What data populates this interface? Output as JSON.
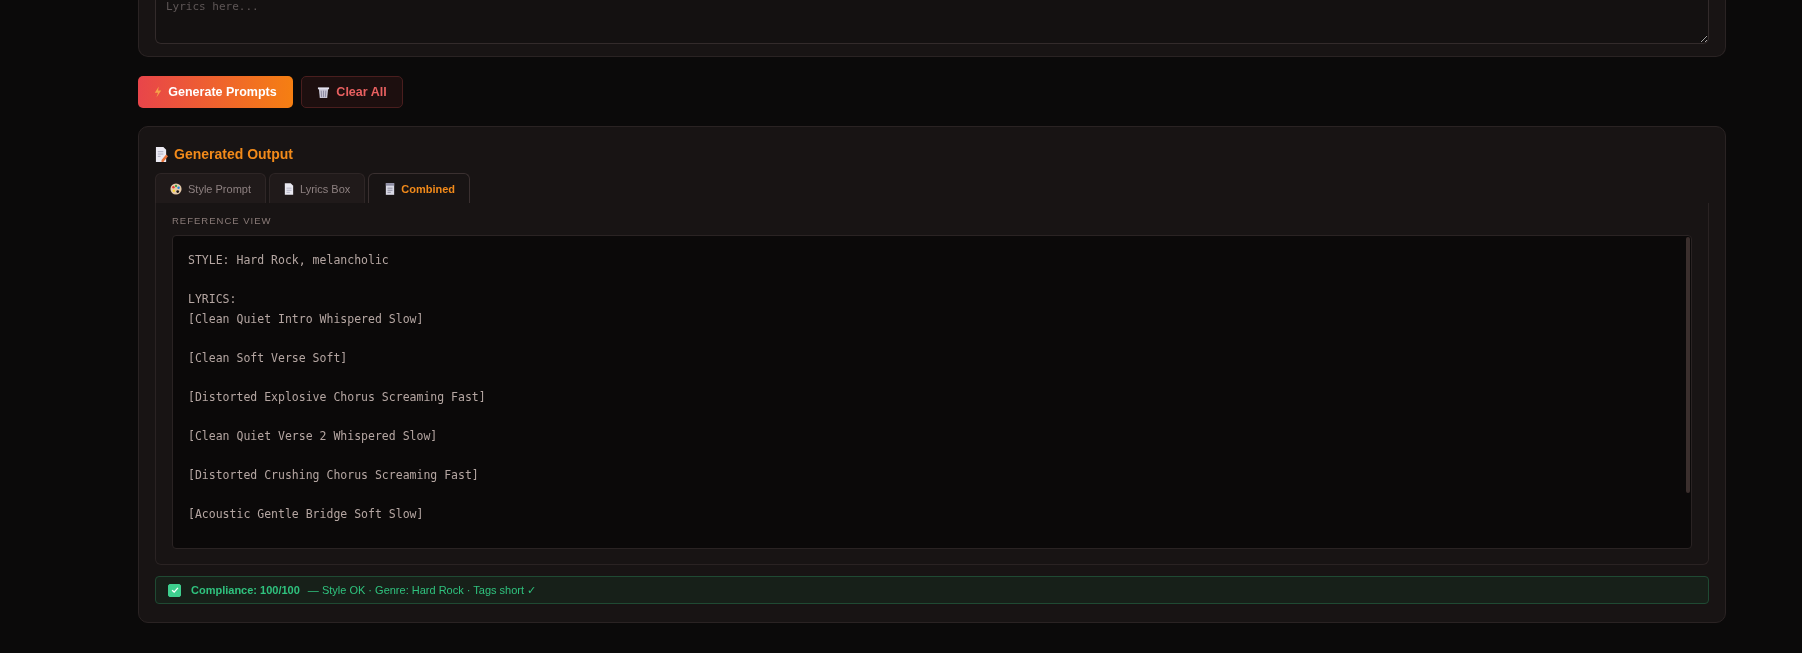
{
  "lyrics_field": {
    "placeholder": "Lyrics here..."
  },
  "actions": [
    {
      "kind": "primary",
      "label": "Generate Prompts"
    },
    {
      "kind": "danger",
      "label": "Clear All"
    }
  ],
  "output": {
    "title": "Generated Output",
    "tabs": [
      {
        "label": "Style Prompt",
        "selected": false
      },
      {
        "label": "Lyrics Box",
        "selected": false
      },
      {
        "label": "Combined",
        "selected": true
      }
    ],
    "section_label": "REFERENCE VIEW",
    "text": "STYLE: Hard Rock, melancholic\n\nLYRICS:\n[Clean Quiet Intro Whispered Slow]\n\n[Clean Soft Verse Soft]\n\n[Distorted Explosive Chorus Screaming Fast]\n\n[Clean Quiet Verse 2 Whispered Slow]\n\n[Distorted Crushing Chorus Screaming Fast]\n\n[Acoustic Gentle Bridge Soft Slow]",
    "compliance": {
      "checked": true,
      "score": "Compliance: 100/100",
      "details": "— Style OK · Genre: Hard Rock · Tags short ✓"
    }
  }
}
